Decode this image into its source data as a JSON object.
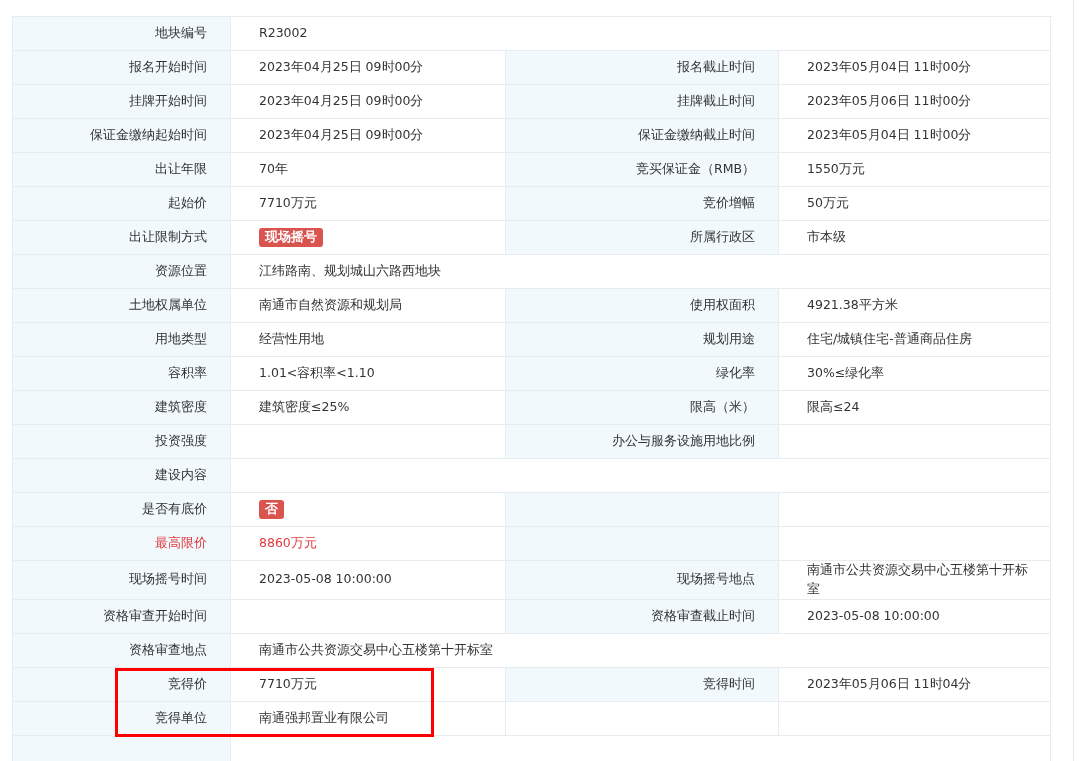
{
  "rows": [
    {
      "kind": "full",
      "left": {
        "label": "地块编号",
        "value": "R23002"
      }
    },
    {
      "kind": "pair",
      "left": {
        "label": "报名开始时间",
        "value": "2023年04月25日 09时00分"
      },
      "right": {
        "label": "报名截止时间",
        "value": "2023年05月04日 11时00分"
      }
    },
    {
      "kind": "pair",
      "left": {
        "label": "挂牌开始时间",
        "value": "2023年04月25日 09时00分"
      },
      "right": {
        "label": "挂牌截止时间",
        "value": "2023年05月06日 11时00分"
      }
    },
    {
      "kind": "pair",
      "left": {
        "label": "保证金缴纳起始时间",
        "value": "2023年04月25日 09时00分"
      },
      "right": {
        "label": "保证金缴纳截止时间",
        "value": "2023年05月04日 11时00分"
      }
    },
    {
      "kind": "pair",
      "left": {
        "label": "出让年限",
        "value": "70年"
      },
      "right": {
        "label": "竞买保证金（RMB）",
        "value": "1550万元"
      }
    },
    {
      "kind": "pair",
      "left": {
        "label": "起始价",
        "value": "7710万元"
      },
      "right": {
        "label": "竞价增幅",
        "value": "50万元"
      }
    },
    {
      "kind": "pair",
      "left": {
        "label": "出让限制方式",
        "value": "现场摇号",
        "kind": "badge"
      },
      "right": {
        "label": "所属行政区",
        "value": "市本级"
      }
    },
    {
      "kind": "full",
      "left": {
        "label": "资源位置",
        "value": "江纬路南、规划城山六路西地块"
      }
    },
    {
      "kind": "pair",
      "left": {
        "label": "土地权属单位",
        "value": "南通市自然资源和规划局"
      },
      "right": {
        "label": "使用权面积",
        "value": "4921.38平方米"
      }
    },
    {
      "kind": "pair",
      "left": {
        "label": "用地类型",
        "value": "经营性用地"
      },
      "right": {
        "label": "规划用途",
        "value": "住宅/城镇住宅-普通商品住房"
      }
    },
    {
      "kind": "pair",
      "left": {
        "label": "容积率",
        "value": "1.01<容积率<1.10"
      },
      "right": {
        "label": "绿化率",
        "value": "30%≤绿化率"
      }
    },
    {
      "kind": "pair",
      "left": {
        "label": "建筑密度",
        "value": "建筑密度≤25%"
      },
      "right": {
        "label": "限高（米）",
        "value": "限高≤24"
      }
    },
    {
      "kind": "pair",
      "left": {
        "label": "投资强度"
      },
      "right": {
        "label": "办公与服务设施用地比例"
      }
    },
    {
      "kind": "full",
      "left": {
        "label": "建设内容"
      }
    },
    {
      "kind": "pair",
      "left": {
        "label": "是否有底价",
        "value": "否",
        "kind": "badge"
      },
      "right": {}
    },
    {
      "kind": "pair",
      "left": {
        "label": "最高限价",
        "value": "8860万元",
        "kind": "alert"
      },
      "right": {}
    },
    {
      "kind": "pair",
      "left": {
        "label": "现场摇号时间",
        "value": "2023-05-08 10:00:00"
      },
      "right": {
        "label": "现场摇号地点",
        "value": "南通市公共资源交易中心五楼第十开标室"
      }
    },
    {
      "kind": "pair",
      "left": {
        "label": "资格审查开始时间"
      },
      "right": {
        "label": "资格审查截止时间",
        "value": "2023-05-08 10:00:00"
      }
    },
    {
      "kind": "full",
      "left": {
        "label": "资格审查地点",
        "value": "南通市公共资源交易中心五楼第十开标室"
      }
    },
    {
      "kind": "pair",
      "highlighted": true,
      "left": {
        "label": "竞得价",
        "value": "7710万元"
      },
      "right": {
        "label": "竞得时间",
        "value": "2023年05月06日 11时04分"
      }
    },
    {
      "kind": "single",
      "highlighted": true,
      "left": {
        "label": "竞得单位",
        "value": "南通强邦置业有限公司"
      }
    }
  ]
}
